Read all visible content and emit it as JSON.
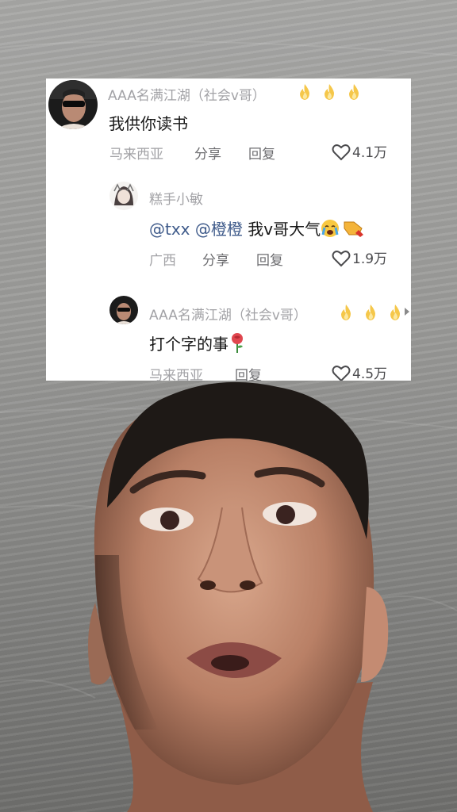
{
  "comments": [
    {
      "user": "AAA名满江湖（社会v哥）",
      "badges": [
        "fire-icon",
        "fire-icon",
        "fire-icon"
      ],
      "text": "我供你读书",
      "location": "马来西亚",
      "share_label": "分享",
      "reply_label": "回复",
      "likes": "4.1万"
    },
    {
      "user": "糕手小敏",
      "mention1": "@txx",
      "mention2": "@橙橙",
      "text": "我v哥大气",
      "emojis": [
        "crying-face-icon",
        "clapping-hand-icon"
      ],
      "location": "广西",
      "share_label": "分享",
      "reply_label": "回复",
      "likes": "1.9万"
    },
    {
      "user": "AAA名满江湖（社会v哥）",
      "badges": [
        "fire-icon",
        "fire-icon",
        "fire-icon"
      ],
      "text": "打个字的事",
      "emojis": [
        "rose-icon"
      ],
      "location": "马来西亚",
      "reply_label": "回复",
      "likes": "4.5万"
    }
  ],
  "colors": {
    "card_bg": "#ffffff",
    "meta_text": "#a2a2a6",
    "mention": "#3e5a8a",
    "fire": "#f5c74a"
  }
}
